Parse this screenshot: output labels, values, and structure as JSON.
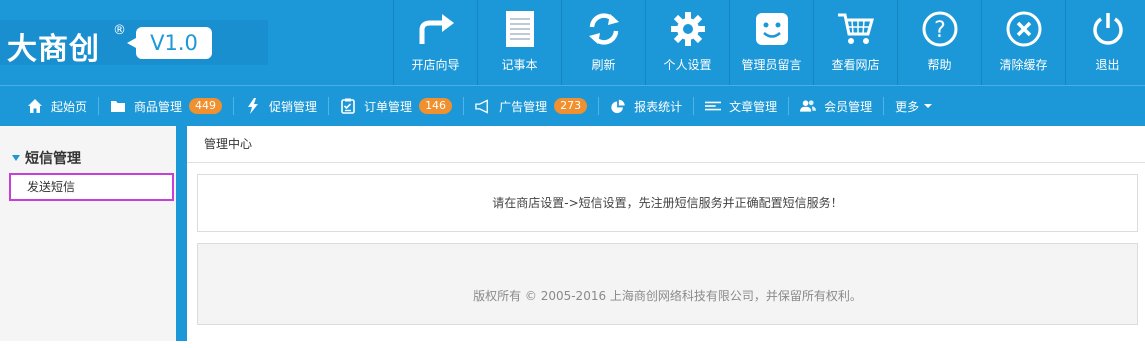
{
  "logo": {
    "text": "大商创",
    "reg": "®",
    "version": "V1.0"
  },
  "top_nav": [
    {
      "label": "开店向导",
      "icon": "arrow-turn-right-icon"
    },
    {
      "label": "记事本",
      "icon": "notepad-icon"
    },
    {
      "label": "刷新",
      "icon": "refresh-icon"
    },
    {
      "label": "个人设置",
      "icon": "gear-icon"
    },
    {
      "label": "管理员留言",
      "icon": "smiley-message-icon"
    },
    {
      "label": "查看网店",
      "icon": "cart-icon"
    },
    {
      "label": "帮助",
      "icon": "help-icon"
    },
    {
      "label": "清除缓存",
      "icon": "clear-cache-icon"
    },
    {
      "label": "退出",
      "icon": "power-icon"
    }
  ],
  "sub_nav": [
    {
      "label": "起始页",
      "icon": "home-icon"
    },
    {
      "label": "商品管理",
      "icon": "folder-icon",
      "badge": "449"
    },
    {
      "label": "促销管理",
      "icon": "lightning-icon"
    },
    {
      "label": "订单管理",
      "icon": "clipboard-icon",
      "badge": "146"
    },
    {
      "label": "广告管理",
      "icon": "megaphone-icon",
      "badge": "273"
    },
    {
      "label": "报表统计",
      "icon": "pie-chart-icon"
    },
    {
      "label": "文章管理",
      "icon": "list-icon"
    },
    {
      "label": "会员管理",
      "icon": "users-icon"
    },
    {
      "label": "更多",
      "icon": "chevron-down-icon"
    }
  ],
  "sidebar": {
    "group_label": "短信管理",
    "items": [
      {
        "label": "发送短信"
      }
    ]
  },
  "main": {
    "breadcrumb": "管理中心",
    "notice": "请在商店设置->短信设置，先注册短信服务并正确配置短信服务！",
    "footer": "版权所有 © 2005-2016 上海商创网络科技有限公司，并保留所有权利。"
  },
  "colors": {
    "primary": "#1c98d8",
    "badge": "#f0902f",
    "highlight_border": "#c63fd8"
  }
}
